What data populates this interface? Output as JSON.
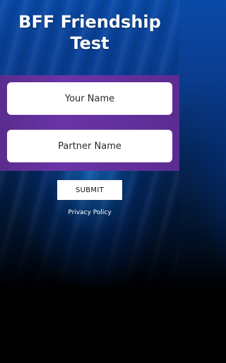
{
  "app": {
    "title_line1": "BFF Friendship",
    "title_line2": "Test"
  },
  "form": {
    "your_name_placeholder": "Your Name",
    "partner_name_placeholder": "Partner Name",
    "submit_label": "SUBMIT"
  },
  "footer": {
    "privacy_label": "Privacy Policy"
  },
  "colors": {
    "band": "#6a34a6",
    "background_top": "#0a4aa8",
    "background_bottom": "#000000",
    "field_bg": "#ffffff"
  }
}
